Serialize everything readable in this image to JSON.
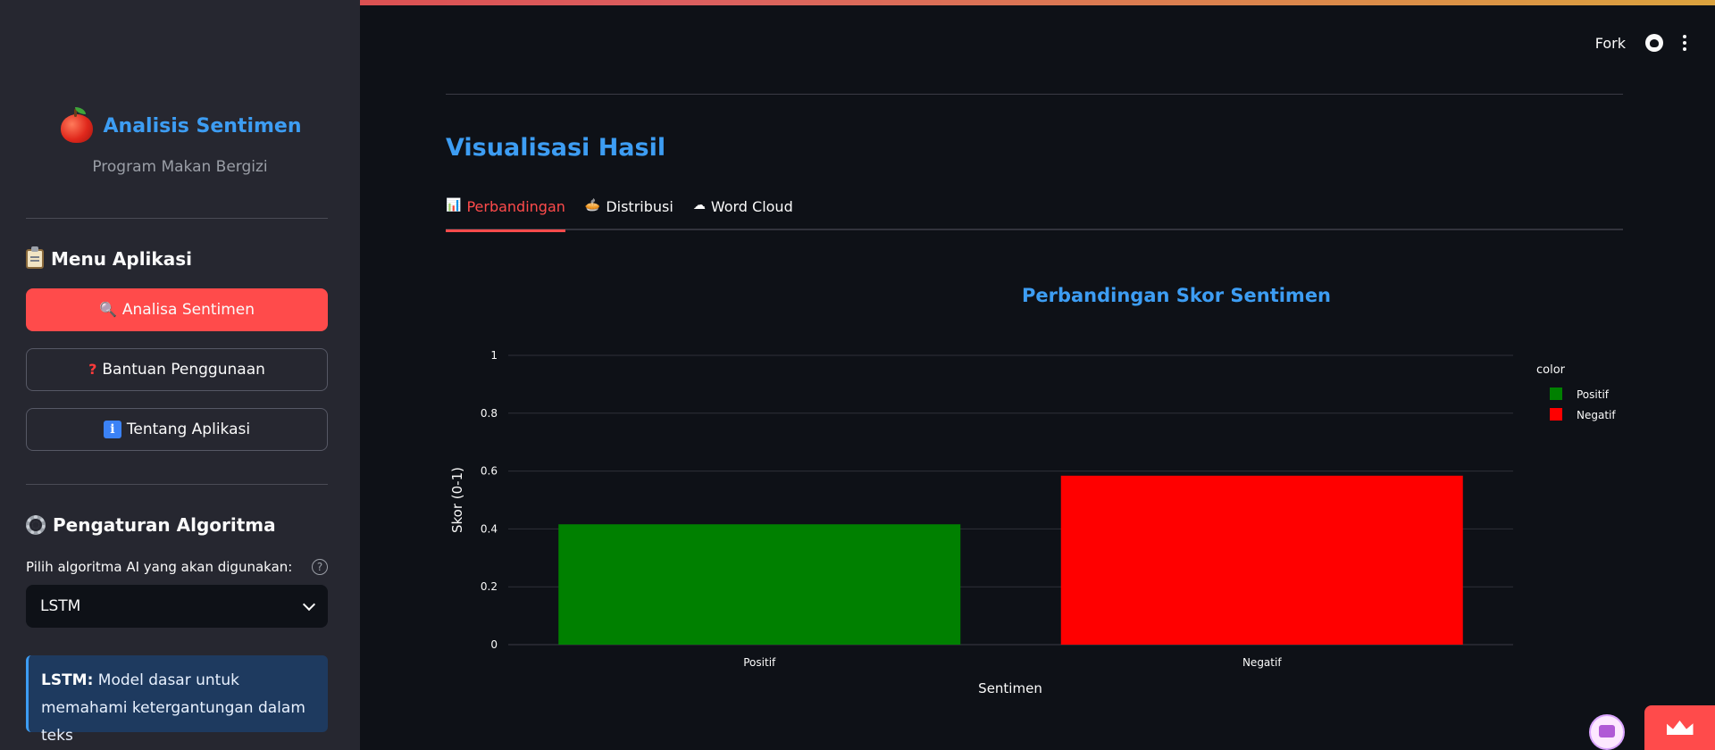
{
  "sidebar": {
    "brand_title": "Analisis Sentimen",
    "brand_subtitle": "Program Makan Bergizi",
    "menu_heading": "Menu Aplikasi",
    "menu": [
      {
        "label": "Analisa Sentimen",
        "icon": "magnifier-icon",
        "active": true
      },
      {
        "label": "Bantuan Penggunaan",
        "icon": "question-icon",
        "active": false
      },
      {
        "label": "Tentang Aplikasi",
        "icon": "info-icon",
        "active": false
      }
    ],
    "settings_heading": "Pengaturan Algoritma",
    "algo_label": "Pilih algoritma AI yang akan digunakan:",
    "algo_selected": "LSTM",
    "info_bold": "LSTM:",
    "info_text": "Model dasar untuk memahami ketergantungan dalam teks"
  },
  "header": {
    "fork_label": "Fork"
  },
  "main": {
    "title": "Visualisasi Hasil",
    "tabs": [
      {
        "label": "Perbandingan",
        "icon": "bar-chart-icon",
        "active": true
      },
      {
        "label": "Distribusi",
        "icon": "pie-icon",
        "active": false
      },
      {
        "label": "Word Cloud",
        "icon": "cloud-icon",
        "active": false
      }
    ]
  },
  "colors": {
    "accent": "#ff4b4b",
    "title_blue": "#3d9df3",
    "positive": "#008000",
    "negative": "#ff0000"
  },
  "chart_data": {
    "type": "bar",
    "title": "Perbandingan Skor Sentimen",
    "xlabel": "Sentimen",
    "ylabel": "Skor (0-1)",
    "categories": [
      "Positif",
      "Negatif"
    ],
    "values": [
      0.416,
      0.584
    ],
    "colors": [
      "#008000",
      "#ff0000"
    ],
    "ylim": [
      0,
      1
    ],
    "yticks": [
      "0",
      "0.2",
      "0.4",
      "0.6",
      "0.8",
      "1"
    ],
    "legend_title": "color",
    "legend": [
      "Positif",
      "Negatif"
    ],
    "legend_position": "top-right",
    "grid": true
  }
}
